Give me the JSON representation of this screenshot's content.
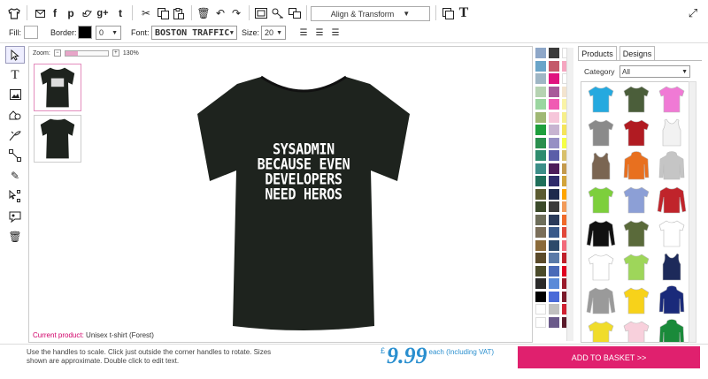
{
  "toolbar": {
    "align_transform_label": "Align & Transform"
  },
  "props": {
    "fill_label": "Fill:",
    "border_label": "Border:",
    "border_width": "0",
    "font_label": "Font:",
    "font_value": "BOSTON TRAFFIC",
    "size_label": "Size:",
    "size_value": "20",
    "border_color": "#000000",
    "fill_color": "#ffffff"
  },
  "canvas": {
    "zoom_label": "Zoom:",
    "zoom_value": "130%",
    "zoom_level_fraction": 0.3,
    "current_product_label": "Current product:",
    "current_product_value": "Unisex t-shirt (Forest)",
    "print_lines": [
      "SYSADMIN",
      "BECAUSE EVEN",
      "DEVELOPERS",
      "NEED HEROS"
    ],
    "shirt_color": "#1e231e"
  },
  "palette": [
    [
      "#8ea7c8",
      "#3b3b3b",
      "#ffffff"
    ],
    [
      "#6aa5c9",
      "#c45a6a",
      "#f5a6c0"
    ],
    [
      "#9fb6c5",
      "#e0147f",
      "#ffffff"
    ],
    [
      "#b6d3b2",
      "#a85a9a",
      "#f3e4cf"
    ],
    [
      "#9bd6a0",
      "#f05bb3",
      "#f9f3a6"
    ],
    [
      "#a0b874",
      "#f6c6da",
      "#f6ef8a"
    ],
    [
      "#1e9f3d",
      "#c7b4d1",
      "#f4e45b"
    ],
    [
      "#2a8f4e",
      "#9690c4",
      "#f5ff47"
    ],
    [
      "#2e8c6e",
      "#5b5ea8",
      "#d8c06b"
    ],
    [
      "#3c8e88",
      "#4d1d5a",
      "#c49a4d"
    ],
    [
      "#1f6f5a",
      "#2f2c6b",
      "#d2a43b"
    ],
    [
      "#5b5b30",
      "#1d2a4d",
      "#ffa500"
    ],
    [
      "#3b4a2a",
      "#3a3a3a",
      "#f29b5a"
    ],
    [
      "#6d6d5a",
      "#2a3a5a",
      "#f06a2a"
    ],
    [
      "#7a6e5a",
      "#3a5a8a",
      "#e2483a"
    ],
    [
      "#8a6a3a",
      "#2d4a6a",
      "#f26a7a"
    ],
    [
      "#5a4a2a",
      "#5a7aa8",
      "#c0202a"
    ],
    [
      "#4a4a2a",
      "#4a6ab8",
      "#e00020"
    ],
    [
      "#2a2a2a",
      "#5a8ad8",
      "#9a1a2a"
    ],
    [
      "#000000",
      "#4a6ad8",
      "#7a1a2a"
    ],
    [
      "#ffffff",
      "#c0c0c0",
      "#d02030"
    ],
    [
      "#ffffff",
      "#6a5a8a",
      "#5a1a2a"
    ]
  ],
  "panel": {
    "tab_products": "Products",
    "tab_designs": "Designs",
    "category_label": "Category",
    "category_value": "All",
    "products": [
      {
        "color": "#25a9df",
        "style": "tee"
      },
      {
        "color": "#4b5e3a",
        "style": "tee"
      },
      {
        "color": "#f07ad5",
        "style": "tee"
      },
      {
        "color": "#8a8a8a",
        "style": "tee"
      },
      {
        "color": "#b11b22",
        "style": "tee"
      },
      {
        "color": "#f2f2f2",
        "style": "vest"
      },
      {
        "color": "#7a6552",
        "style": "vest"
      },
      {
        "color": "#e8701f",
        "style": "hoodie"
      },
      {
        "color": "#c5c5c5",
        "style": "hoodie"
      },
      {
        "color": "#7dcf3c",
        "style": "tee"
      },
      {
        "color": "#8c9fd6",
        "style": "tee"
      },
      {
        "color": "#c0242b",
        "style": "longsleeve"
      },
      {
        "color": "#111111",
        "style": "longsleeve"
      },
      {
        "color": "#5a6a3a",
        "style": "tee"
      },
      {
        "color": "#ffffff",
        "style": "tee"
      },
      {
        "color": "#ffffff",
        "style": "tee"
      },
      {
        "color": "#9ed65a",
        "style": "tee"
      },
      {
        "color": "#1d2a5a",
        "style": "vest"
      },
      {
        "color": "#9a9a9a",
        "style": "longsleeve"
      },
      {
        "color": "#f7d21a",
        "style": "tee"
      },
      {
        "color": "#1a2a7a",
        "style": "hoodie"
      },
      {
        "color": "#f0dc2a",
        "style": "tee"
      },
      {
        "color": "#f8d0dc",
        "style": "tee"
      },
      {
        "color": "#1a8a3a",
        "style": "hoodie"
      }
    ]
  },
  "footer": {
    "help_text": "Use the handles to scale. Click just outside the corner handles to rotate. Sizes shown are approximate. Double click to edit text.",
    "price_currency": "£",
    "price_amount": "9.99",
    "price_note": "each (Including VAT)",
    "basket_label": "ADD TO BASKET >>"
  },
  "colors": {
    "accent": "#e0206e",
    "price": "#2a8fcf"
  }
}
